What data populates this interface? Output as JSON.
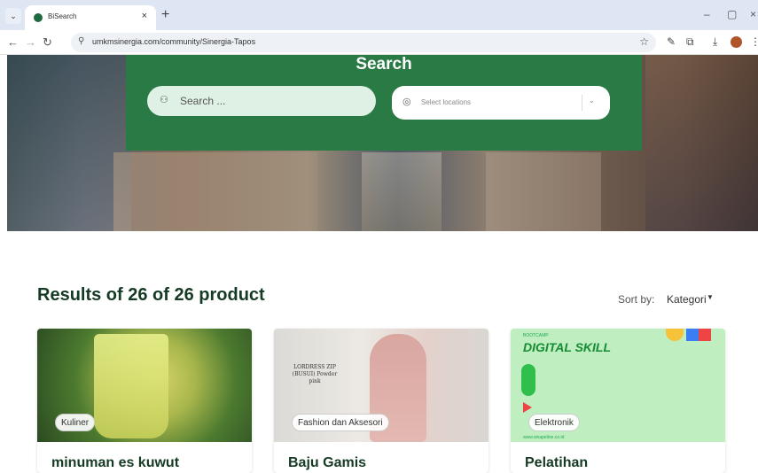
{
  "browser": {
    "tab_title": "BiSearch",
    "tab_close": "×",
    "new_tab": "+",
    "url": "umkmsinergia.com/community/Sinergia-Tapos",
    "window_controls": [
      "–",
      "▢",
      "×"
    ]
  },
  "hero": {
    "title": "Search",
    "search_placeholder": "Search ...",
    "location_placeholder": "Select locations"
  },
  "results": {
    "title": "Results of 26 of 26 product",
    "sort_label": "Sort by:",
    "sort_value": "Kategori"
  },
  "products": [
    {
      "category": "Kuliner",
      "name": "minuman es kuwut"
    },
    {
      "category": "Fashion dan Aksesori",
      "name": "Baju Gamis",
      "image_text": "LORDRESS ZIP (BUSUI) Powder pink"
    },
    {
      "category": "Elektronik",
      "name": "Pelatihan",
      "image_top": "BOOTCAMP",
      "image_title": "DIGITAL SKILL",
      "image_url": "www.sinapeline.co.id"
    }
  ],
  "colors": {
    "brand_green": "#2a7a45",
    "title_green": "#163b24"
  }
}
